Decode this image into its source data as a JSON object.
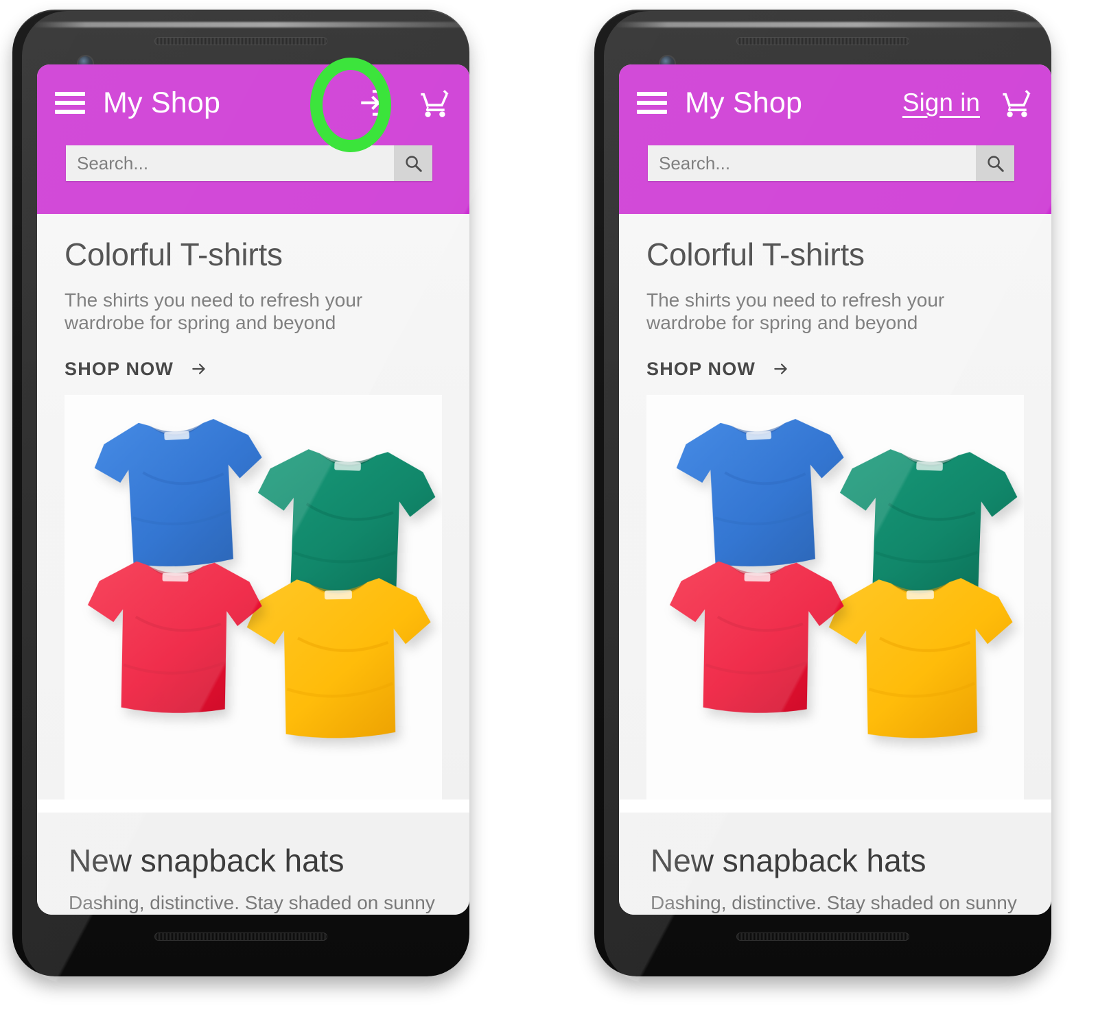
{
  "app": {
    "brand": "My Shop",
    "header_color": "#cb2ed2",
    "annotation_color": "#1fe01f"
  },
  "search": {
    "placeholder": "Search...",
    "value": "",
    "button_icon": "search-icon"
  },
  "icons": {
    "menu": "hamburger-menu-icon",
    "cart": "shopping-cart-icon",
    "login": "login-arrow-icon",
    "search": "search-icon",
    "arrow_right": "arrow-right-icon"
  },
  "hero": {
    "title": "Colorful T-shirts",
    "subtitle": "The shirts you need to refresh your wardrobe for spring and beyond",
    "cta_label": "SHOP NOW",
    "cta_icon": "arrow-right-icon",
    "shirt_colors": {
      "blue": "#1763cc",
      "green": "#11876a",
      "red": "#ee1133",
      "yellow": "#ffbc0a"
    }
  },
  "second_section": {
    "title": "New snapback hats",
    "subtitle": "Dashing, distinctive. Stay shaded on sunny"
  },
  "variants": [
    {
      "id": "icon-variant",
      "login_mode": "icon",
      "login_label": "",
      "login_icon": "login-arrow-icon",
      "highlight_shape": "oval"
    },
    {
      "id": "text-variant",
      "login_mode": "text",
      "login_label": "Sign in",
      "login_icon": "",
      "highlight_shape": "circle"
    }
  ]
}
